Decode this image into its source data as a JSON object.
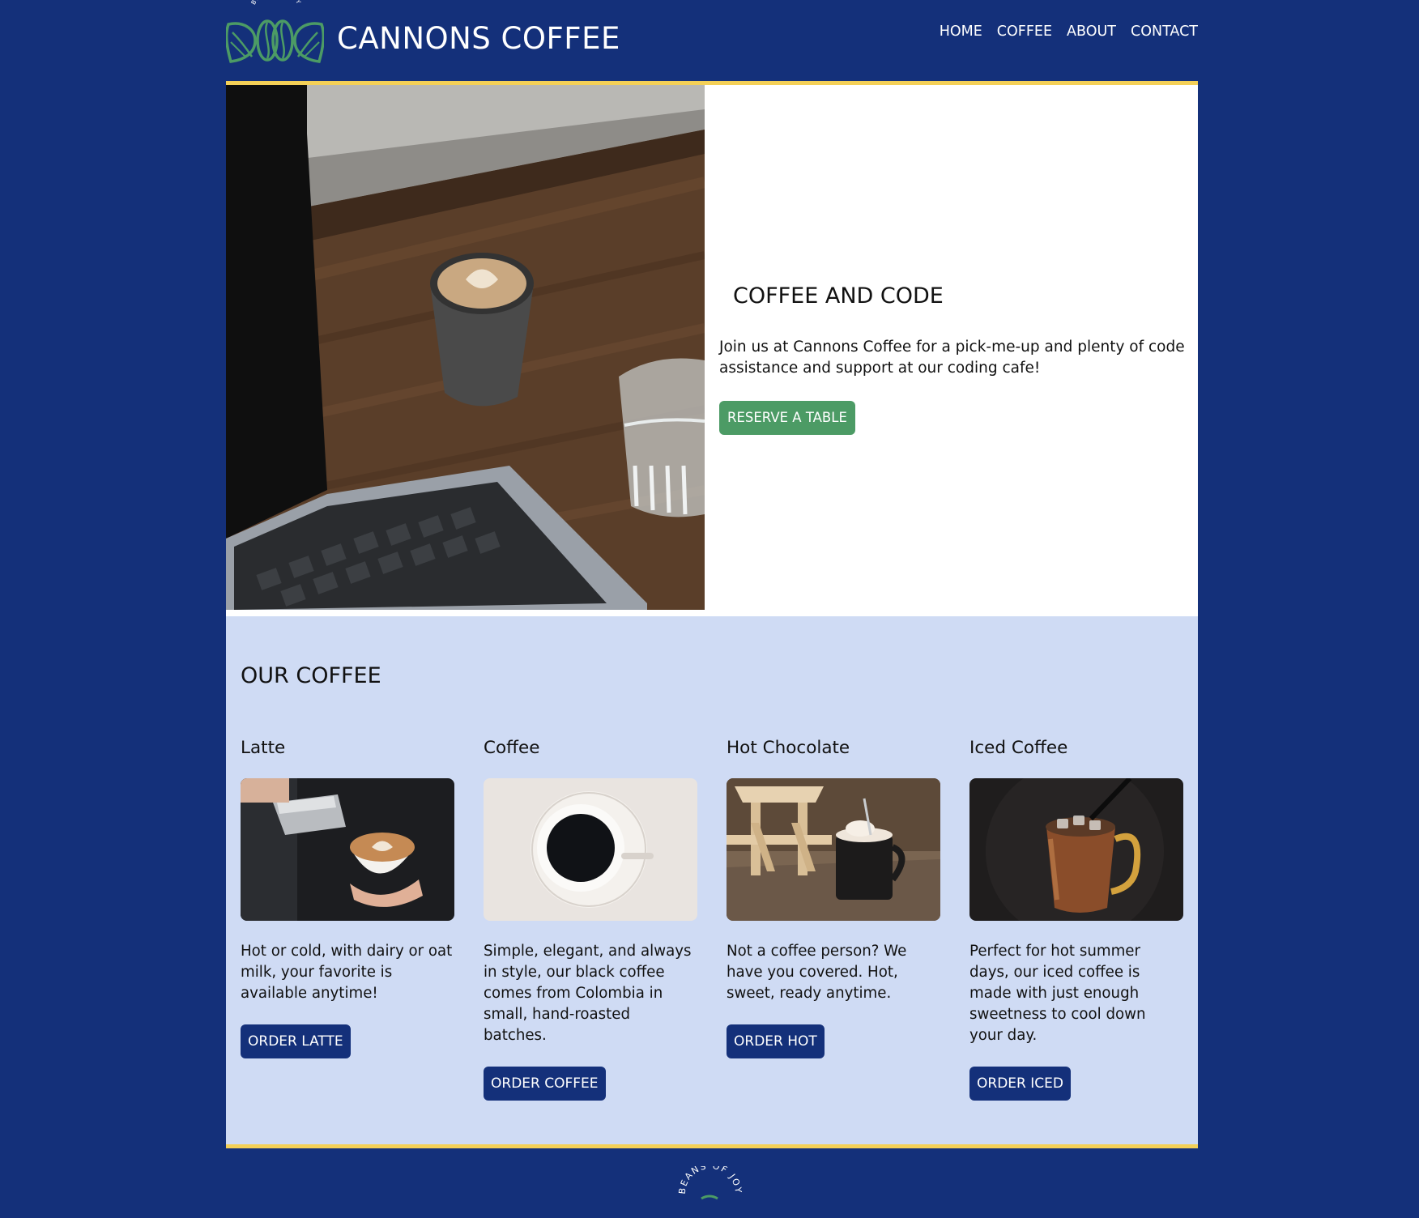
{
  "brand": {
    "title": "CANNONS COFFEE",
    "logo_tagline": "BEANS OF JOY"
  },
  "nav": {
    "items": [
      "HOME",
      "COFFEE",
      "ABOUT",
      "CONTACT"
    ]
  },
  "hero": {
    "heading": "COFFEE AND CODE",
    "text": "Join us at Cannons Coffee for a pick-me-up and plenty of code assistance and support at our coding cafe!",
    "button": "RESERVE A TABLE"
  },
  "coffee": {
    "title": "OUR COFFEE",
    "cards": [
      {
        "title": "Latte",
        "text": "Hot or cold, with dairy or oat milk, your favorite is available anytime!",
        "button": "ORDER LATTE"
      },
      {
        "title": "Coffee",
        "text": "Simple, elegant, and always in style, our black coffee comes from Colombia in small, hand-roasted batches.",
        "button": "ORDER COFFEE"
      },
      {
        "title": "Hot Chocolate",
        "text": "Not a coffee person? We have you covered. Hot, sweet, ready anytime.",
        "button": "ORDER HOT"
      },
      {
        "title": "Iced Coffee",
        "text": "Perfect for hot summer days, our iced coffee is made with just enough sweetness to cool down your day.",
        "button": "ORDER ICED"
      }
    ]
  },
  "colors": {
    "background": "#14307a",
    "accent_border": "#f4d057",
    "section_background": "#cfdbf4",
    "reserve_button": "#4c9b65",
    "order_button": "#14307a",
    "logo_green": "#4c9b65"
  },
  "icons": {
    "logo": "coffee-bean-leaves-logo",
    "footer_logo": "coffee-bean-leaves-logo"
  }
}
